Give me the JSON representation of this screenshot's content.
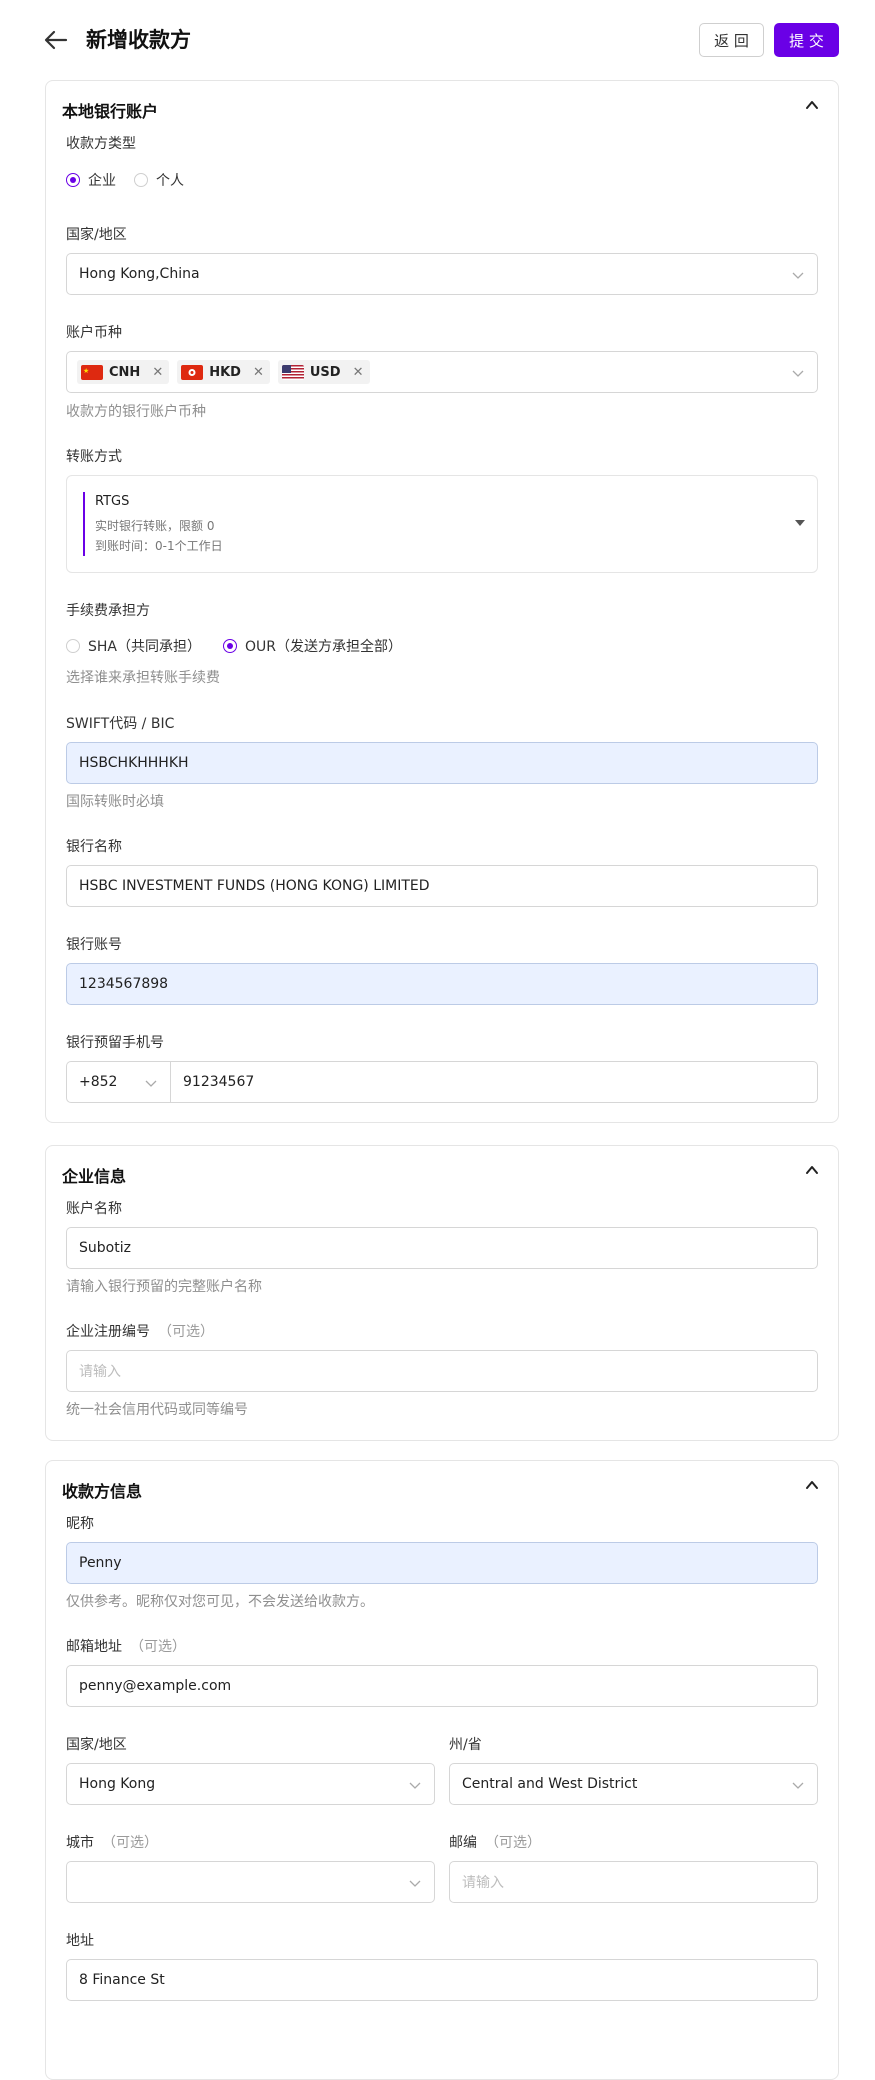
{
  "header": {
    "title": "新增收款方",
    "back_label": "返 回",
    "submit_label": "提 交"
  },
  "bank": {
    "title": "本地银行账户",
    "payee_type": {
      "label": "收款方类型",
      "options": [
        "企业",
        "个人"
      ],
      "selected": "企业"
    },
    "country": {
      "label": "国家/地区",
      "value": "Hong Kong,China"
    },
    "currency": {
      "label": "账户币种",
      "tags": [
        "CNH",
        "HKD",
        "USD"
      ],
      "hint": "收款方的银行账户币种"
    },
    "method": {
      "label": "转账方式",
      "title": "RTGS",
      "line1": "实时银行转账，限额 0",
      "line2": "到账时间：0-1个工作日"
    },
    "fee": {
      "label": "手续费承担方",
      "options": [
        "SHA（共同承担）",
        "OUR（发送方承担全部）"
      ],
      "selected": "OUR（发送方承担全部）",
      "hint": "选择谁来承担转账手续费"
    },
    "swift": {
      "label": "SWIFT代码 / BIC",
      "value": "HSBCHKHHHKH",
      "hint": "国际转账时必填"
    },
    "bank_name": {
      "label": "银行名称",
      "value": "HSBC INVESTMENT FUNDS (HONG KONG) LIMITED"
    },
    "account_no": {
      "label": "银行账号",
      "value": "1234567898"
    },
    "phone": {
      "label": "银行预留手机号",
      "code": "+852",
      "number": "91234567"
    }
  },
  "company": {
    "title": "企业信息",
    "account_name": {
      "label": "账户名称",
      "value": "Subotiz",
      "hint": "请输入银行预留的完整账户名称"
    },
    "reg_no": {
      "label": "企业注册编号",
      "optional": "（可选）",
      "placeholder": "请输入",
      "hint": "统一社会信用代码或同等编号"
    }
  },
  "payee": {
    "title": "收款方信息",
    "nickname": {
      "label": "昵称",
      "value": "Penny",
      "hint": "仅供参考。昵称仅对您可见，不会发送给收款方。"
    },
    "email": {
      "label": "邮箱地址",
      "optional": "（可选）",
      "value": "penny@example.com"
    },
    "country": {
      "label": "国家/地区",
      "value": "Hong Kong"
    },
    "state": {
      "label": "州/省",
      "value": "Central and West District"
    },
    "city": {
      "label": "城市",
      "optional": "（可选）",
      "value": ""
    },
    "postcode": {
      "label": "邮编",
      "optional": "（可选）",
      "placeholder": "请输入"
    },
    "address": {
      "label": "地址",
      "value": "8 Finance St"
    }
  },
  "colors": {
    "accent": "#6a00e6",
    "highlight": "#eaf1ff",
    "border": "#d6d6d6"
  }
}
